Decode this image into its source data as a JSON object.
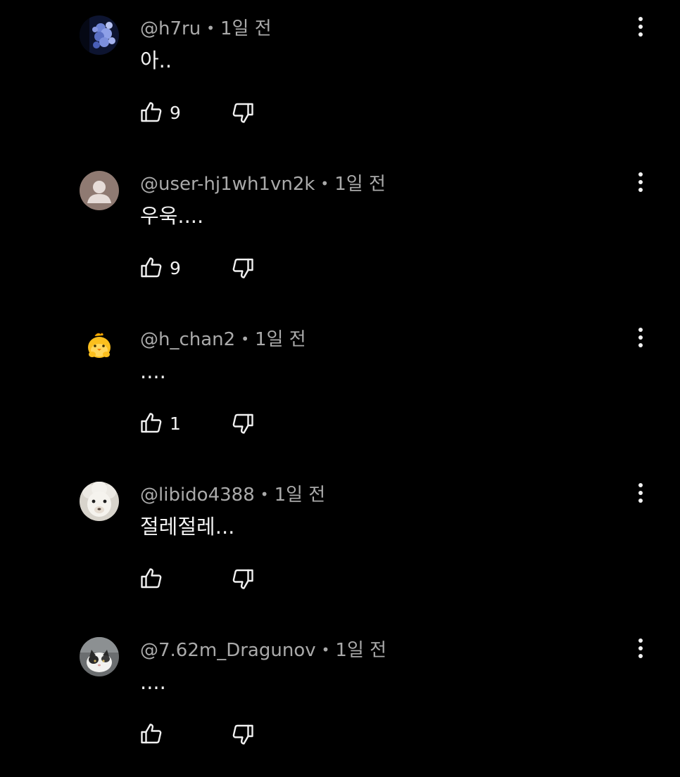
{
  "comments": [
    {
      "author": "@h7ru",
      "time": "1일 전",
      "text": "아..",
      "likes": "9",
      "avatar_icon": "blue-flowers-photo-avatar"
    },
    {
      "author": "@user-hj1wh1vn2k",
      "time": "1일 전",
      "text": "우욱....",
      "likes": "9",
      "avatar_icon": "default-person-avatar"
    },
    {
      "author": "@h_chan2",
      "time": "1일 전",
      "text": "....",
      "likes": "1",
      "avatar_icon": "yellow-chick-character-avatar"
    },
    {
      "author": "@libido4388",
      "time": "1일 전",
      "text": "절레절레...",
      "likes": "",
      "avatar_icon": "alpaca-photo-avatar"
    },
    {
      "author": "@7.62m_Dragunov",
      "time": "1일 전",
      "text": "....",
      "likes": "",
      "avatar_icon": "cat-photo-avatar"
    }
  ],
  "separator": "•",
  "colors": {
    "background": "#000000",
    "text_primary": "#f1f1f1",
    "text_secondary": "#aaaaaa"
  }
}
